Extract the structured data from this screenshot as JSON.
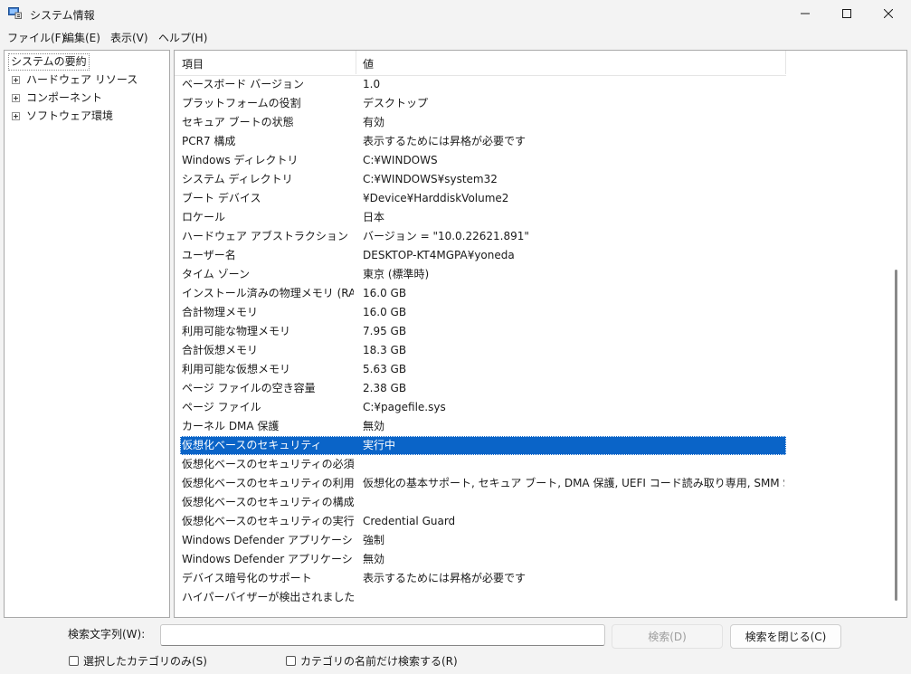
{
  "window": {
    "title": "システム情報"
  },
  "menu": [
    "ファイル(F)",
    "編集(E)",
    "表示(V)",
    "ヘルプ(H)"
  ],
  "tree": {
    "root": "システムの要約",
    "items": [
      "ハードウェア リソース",
      "コンポーネント",
      "ソフトウェア環境"
    ]
  },
  "table": {
    "headers": {
      "item": "項目",
      "value": "値"
    },
    "rows": [
      {
        "item": "ベースボード バージョン",
        "value": "1.0"
      },
      {
        "item": "プラットフォームの役割",
        "value": "デスクトップ"
      },
      {
        "item": "セキュア ブートの状態",
        "value": "有効"
      },
      {
        "item": "PCR7 構成",
        "value": "表示するためには昇格が必要です"
      },
      {
        "item": "Windows ディレクトリ",
        "value": "C:¥WINDOWS"
      },
      {
        "item": "システム ディレクトリ",
        "value": "C:¥WINDOWS¥system32"
      },
      {
        "item": "ブート デバイス",
        "value": "¥Device¥HarddiskVolume2"
      },
      {
        "item": "ロケール",
        "value": "日本"
      },
      {
        "item": "ハードウェア アブストラクション レイヤー",
        "value": "バージョン = \"10.0.22621.891\""
      },
      {
        "item": "ユーザー名",
        "value": "DESKTOP-KT4MGPA¥yoneda"
      },
      {
        "item": "タイム ゾーン",
        "value": "東京 (標準時)"
      },
      {
        "item": "インストール済みの物理メモリ (RAM)",
        "value": "16.0 GB"
      },
      {
        "item": "合計物理メモリ",
        "value": "16.0 GB"
      },
      {
        "item": "利用可能な物理メモリ",
        "value": "7.95 GB"
      },
      {
        "item": "合計仮想メモリ",
        "value": "18.3 GB"
      },
      {
        "item": "利用可能な仮想メモリ",
        "value": "5.63 GB"
      },
      {
        "item": "ページ ファイルの空き容量",
        "value": "2.38 GB"
      },
      {
        "item": "ページ ファイル",
        "value": "C:¥pagefile.sys"
      },
      {
        "item": "カーネル DMA 保護",
        "value": "無効"
      },
      {
        "item": "仮想化ベースのセキュリティ",
        "value": "実行中"
      },
      {
        "item": "仮想化ベースのセキュリティの必須セ...",
        "value": ""
      },
      {
        "item": "仮想化ベースのセキュリティの利用...",
        "value": "仮想化の基本サポート, セキュア ブート, DMA 保護, UEFI コード読み取り専用, SMM Se..."
      },
      {
        "item": "仮想化ベースのセキュリティの構成...",
        "value": ""
      },
      {
        "item": "仮想化ベースのセキュリティの実行...",
        "value": "Credential Guard"
      },
      {
        "item": "Windows Defender アプリケーショ...",
        "value": "強制"
      },
      {
        "item": "Windows Defender アプリケーショ...",
        "value": "無効"
      },
      {
        "item": "デバイス暗号化のサポート",
        "value": "表示するためには昇格が必要です"
      },
      {
        "item": "ハイパーバイザーが検出されました。H...",
        "value": ""
      }
    ]
  },
  "search": {
    "label": "検索文字列(W):",
    "value": "",
    "find_button": "検索(D)",
    "close_button": "検索を閉じる(C)",
    "check_selected": "選択したカテゴリのみ(S)",
    "check_names": "カテゴリの名前だけ検索する(R)"
  },
  "colors": {
    "selection": "#0a64c8",
    "background": "#f3f3f3"
  }
}
